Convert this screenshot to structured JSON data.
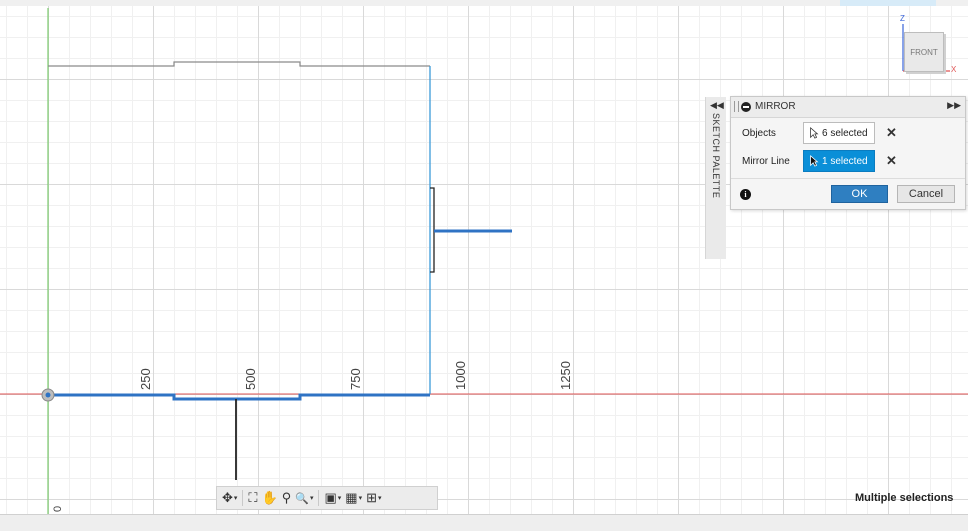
{
  "canvas": {
    "axis_tick_labels": [
      "250",
      "500",
      "750",
      "1000",
      "1250"
    ],
    "origin_label": "0"
  },
  "viewcube": {
    "face_label": "FRONT",
    "axis_z": "Z",
    "axis_x": "X"
  },
  "sketch_palette": {
    "collapse_glyph": "◀◀",
    "label": "SKETCH PALETTE"
  },
  "mirror_dialog": {
    "title": "MIRROR",
    "expand_glyph": "▶▶",
    "objects": {
      "label": "Objects",
      "value": "6 selected",
      "clear_glyph": "✕"
    },
    "mirror_line": {
      "label": "Mirror Line",
      "value": "1 selected",
      "clear_glyph": "✕"
    },
    "info_glyph": "i",
    "ok_label": "OK",
    "cancel_label": "Cancel"
  },
  "nav_toolbar": {
    "items": [
      {
        "icon": "orbit-icon",
        "glyph": "✥",
        "dropdown": "▾"
      },
      {
        "icon": "look-at-icon",
        "glyph": "⛶",
        "dropdown": ""
      },
      {
        "icon": "pan-icon",
        "glyph": "✋",
        "dropdown": ""
      },
      {
        "icon": "zoom-icon",
        "glyph": "⚲",
        "dropdown": ""
      },
      {
        "icon": "fit-icon",
        "glyph": "🔍",
        "dropdown": "▾"
      },
      {
        "icon": "display-settings-icon",
        "glyph": "▣",
        "dropdown": "▾"
      },
      {
        "icon": "grid-icon",
        "glyph": "▦",
        "dropdown": "▾"
      },
      {
        "icon": "viewports-icon",
        "glyph": "⊞",
        "dropdown": "▾"
      }
    ]
  },
  "status": {
    "text": "Multiple selections"
  },
  "colors": {
    "accent": "#0a8fd8",
    "sketch_line": "#2f73c4",
    "x_axis": "#e05555",
    "y_axis": "#7ccc6e",
    "ok_button": "#2f7fc1"
  }
}
